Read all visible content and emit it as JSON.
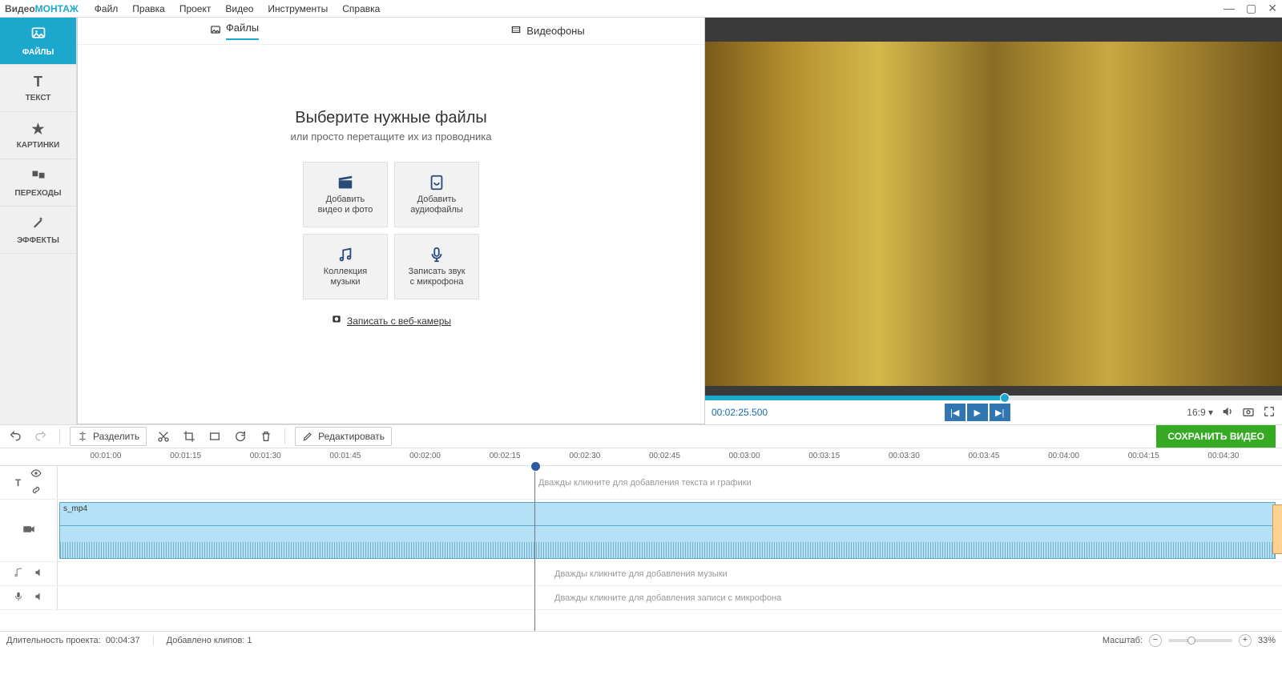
{
  "app": {
    "logo_part1": "Видео",
    "logo_part2": "МОНТАЖ"
  },
  "menu": [
    "Файл",
    "Правка",
    "Проект",
    "Видео",
    "Инструменты",
    "Справка"
  ],
  "sidebar": {
    "items": [
      {
        "label": "ФАЙЛЫ"
      },
      {
        "label": "ТЕКСТ"
      },
      {
        "label": "КАРТИНКИ"
      },
      {
        "label": "ПЕРЕХОДЫ"
      },
      {
        "label": "ЭФФЕКТЫ"
      }
    ]
  },
  "tabs": {
    "files": "Файлы",
    "backgrounds": "Видеофоны"
  },
  "center": {
    "headline": "Выберите нужные файлы",
    "subline": "или просто перетащите их из проводника",
    "cards": {
      "add_video_l1": "Добавить",
      "add_video_l2": "видео и фото",
      "add_audio_l1": "Добавить",
      "add_audio_l2": "аудиофайлы",
      "music_l1": "Коллекция",
      "music_l2": "музыки",
      "mic_l1": "Записать звук",
      "mic_l2": "с микрофона"
    },
    "webcam_link": "Записать с веб-камеры"
  },
  "preview": {
    "timecode": "00:02:25.500",
    "aspect": "16:9 ▾"
  },
  "toolbar": {
    "split": "Разделить",
    "edit": "Редактировать",
    "save": "СОХРАНИТЬ ВИДЕО"
  },
  "ruler": [
    "00:01:00",
    "00:01:15",
    "00:01:30",
    "00:01:45",
    "00:02:00",
    "00:02:15",
    "00:02:30",
    "00:02:45",
    "00:03:00",
    "00:03:15",
    "00:03:30",
    "00:03:45",
    "00:04:00",
    "00:04:15",
    "00:04:30"
  ],
  "tracks": {
    "text_hint": "Дважды кликните для добавления текста и графики",
    "clip_name": "s_mp4",
    "audio_hint": "Дважды кликните для добавления музыки",
    "mic_hint": "Дважды кликните для добавления записи с микрофона"
  },
  "status": {
    "duration_label": "Длительность проекта:",
    "duration_value": "00:04:37",
    "clips_label": "Добавлено клипов:",
    "clips_value": "1",
    "zoom_label": "Масштаб:",
    "zoom_value": "33%"
  }
}
